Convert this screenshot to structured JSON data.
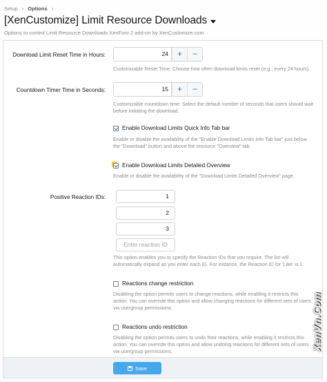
{
  "breadcrumb": {
    "items": [
      "Setup",
      "Options"
    ]
  },
  "header": {
    "title": "[XenCustomize] Limit Resource Downloads",
    "description": "Options to control Limit Resource Downloads XenForo 2 add-on by XenCustomize.com"
  },
  "options": {
    "reset_time": {
      "label": "Download Limit Reset Time in Hours:",
      "value": "24",
      "hint": "Customizable Reset Time: Choose how often download limits reset (e.g., every 24 hours)."
    },
    "countdown": {
      "label": "Countdown Timer Time in Seconds:",
      "value": "15",
      "hint_1": "Customizable countdown time: Select the default number of seconds that users should wait",
      "hint_2": "before initiating the download."
    },
    "quick_info": {
      "label": "Enable Download Limits Quick Info Tab bar",
      "checked": true,
      "hint_1": "Enable or disable the availability of the \"Enable Download Limits Info Tab bar\" just below",
      "hint_2": "the \"Download\" button and above the resource \"Overview\" tab."
    },
    "detailed_overview": {
      "label": "Enable Download Limits Detailed Overview",
      "checked": true,
      "hint": "Enable or disable the availability of the \"Download Limits Detailed Overview\" page."
    },
    "reaction_ids": {
      "label": "Positive Reaction IDs:",
      "values": [
        "1",
        "2",
        "3"
      ],
      "placeholder": "Enter reaction ID",
      "hint_1": "This option enables you to specify the Reaction IDs that you require. The list will",
      "hint_2": "automatically expand as you enter each ID. For instance, the Reaction ID for 'Like' is 1."
    },
    "change_restriction": {
      "label": "Reactions change restriction",
      "checked": false,
      "hint_1": "Disabling the option permits users to change reactions, while enabling it restricts this",
      "hint_2": "action. You can override this option and allow changing reactions for different sets of users",
      "hint_3": "via usergroup permissions."
    },
    "undo_restriction": {
      "label": "Reactions undo restriction",
      "checked": false,
      "hint_1": "Disabling the option permits users to undo their reactions, while enabling it restricts this",
      "hint_2": "action. You can override this option and allow undoing reactions for different sets of users",
      "hint_3": "via usergroup permissions."
    }
  },
  "footer": {
    "save_label": "Save"
  },
  "watermark": "XenVn.Com",
  "colors": {
    "accent": "#2577b1",
    "button": "#47a7eb",
    "hint": "#8a8a8a"
  }
}
